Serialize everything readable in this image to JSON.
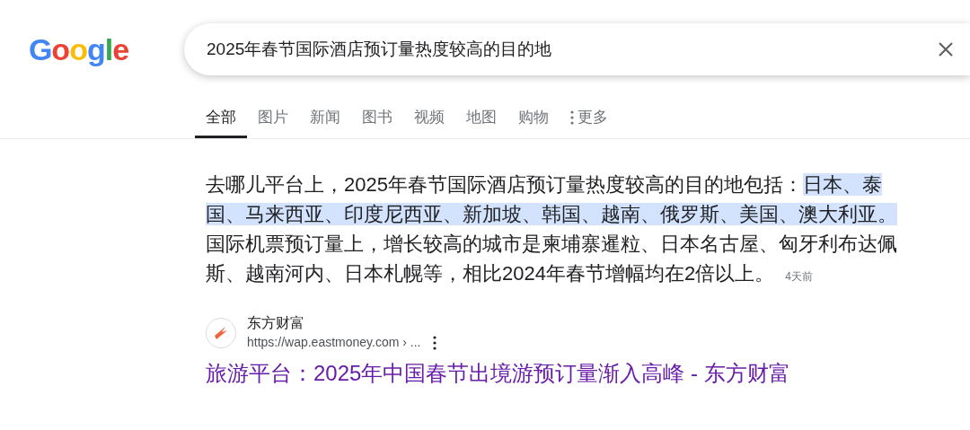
{
  "logo": {
    "text": "Google"
  },
  "search": {
    "value": "2025年春节国际酒店预订量热度较高的目的地"
  },
  "tabs": [
    {
      "label": "全部",
      "selected": true
    },
    {
      "label": "图片",
      "selected": false
    },
    {
      "label": "新闻",
      "selected": false
    },
    {
      "label": "图书",
      "selected": false
    },
    {
      "label": "视频",
      "selected": false
    },
    {
      "label": "地图",
      "selected": false
    },
    {
      "label": "购物",
      "selected": false
    },
    {
      "label": "更多",
      "selected": false,
      "kind": "more"
    }
  ],
  "snippet": {
    "segments": [
      {
        "text": "去哪儿平台上，2025年春节国际酒店预订量热度较高的目的地包括：",
        "highlighted": false
      },
      {
        "text": "日本、泰国、马来西亚、印度尼西亚、新加坡、韩国、越南、俄罗斯、美国、澳大利亚。",
        "highlighted": true
      },
      {
        "text": " 国际机票预订量上，增长较高的城市是柬埔寨暹粒、日本名古屋、匈牙利布达佩斯、越南河内、日本札幌等，相比2024年春节增幅均在2倍以上。",
        "highlighted": false
      }
    ],
    "age": "4天前"
  },
  "result": {
    "site": "东方财富",
    "url": "https://wap.eastmoney.com › ...",
    "title": "旅游平台：2025年中国春节出境游预订量渐入高峰 - 东方财富"
  }
}
